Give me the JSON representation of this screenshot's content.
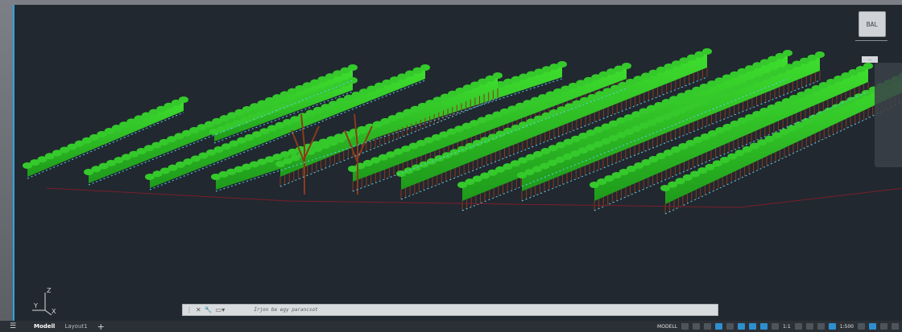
{
  "viewcube": {
    "label": "BAL"
  },
  "navtag": {
    "label": "..."
  },
  "command_line": {
    "placeholder": "Írjon be egy parancsot"
  },
  "ucs": {
    "x_label": "X",
    "y_label": "Y",
    "z_label": "Z"
  },
  "layout_tabs": [
    {
      "label": "Modell"
    },
    {
      "label": "Layout1"
    }
  ],
  "add_tab": "+",
  "status": {
    "mode": "MODELL",
    "scale_ratio": "1:1",
    "anno_scale": "1:500"
  },
  "colors": {
    "hedge": "#2fbf2a",
    "trunk": "#8b3a1a",
    "outline": "#5ad0f0",
    "bg": "#212830",
    "accent": "#2aa6df"
  },
  "scene": {
    "description_visible": false
  }
}
